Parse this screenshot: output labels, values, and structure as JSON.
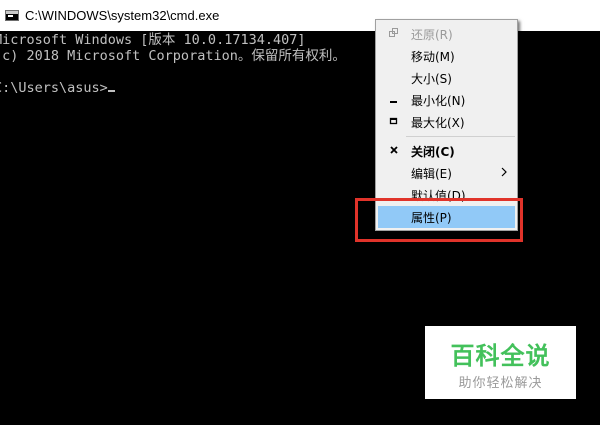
{
  "window": {
    "title": "C:\\WINDOWS\\system32\\cmd.exe",
    "icon": "cmd-icon"
  },
  "console": {
    "lines": [
      "Microsoft Windows [版本 10.0.17134.407]",
      "(c) 2018 Microsoft Corporation。保留所有权利。",
      "",
      "C:\\Users\\asus>"
    ],
    "text_color": "#c0c0c0",
    "background": "#000000"
  },
  "context_menu": {
    "items": [
      {
        "label": "还原(R)",
        "icon": "restore-icon",
        "disabled": true
      },
      {
        "label": "移动(M)",
        "icon": ""
      },
      {
        "label": "大小(S)",
        "icon": ""
      },
      {
        "label": "最小化(N)",
        "icon": "minimize-icon"
      },
      {
        "label": "最大化(X)",
        "icon": "maximize-icon"
      },
      {
        "label": "关闭(C)",
        "icon": "close-icon",
        "bold": true
      },
      {
        "label": "编辑(E)",
        "icon": "",
        "submenu": true
      },
      {
        "label": "默认值(D)",
        "icon": ""
      },
      {
        "label": "属性(P)",
        "icon": "",
        "highlighted": true
      }
    ],
    "highlight_color": "#91c9f7",
    "annotation_color": "#e0332a"
  },
  "watermark": {
    "title": "百科全说",
    "subtitle": "助你轻松解决",
    "title_color": "#43c15b"
  }
}
